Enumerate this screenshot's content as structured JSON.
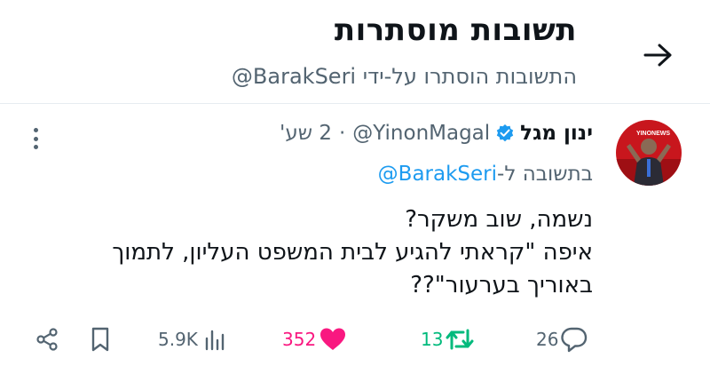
{
  "header": {
    "title": "תשובות מוסתרות",
    "subtitle": "התשובות הוסתרו על-ידי BarakSeri@"
  },
  "tweet": {
    "display_name": "ינון מגל",
    "handle": "@YinonMagal",
    "separator": "·",
    "time": "2 שע'",
    "reply_prefix": "בתשובה ל-",
    "reply_handle": "@BarakSeri",
    "avatar_text": "YINONEWS",
    "text_lines": [
      "נשמה, שוב משקר?",
      "איפה \"קראתי להגיע לבית המשפט העליון, לתמוך",
      "באוריך בערעור\"??"
    ]
  },
  "actions": {
    "views": "5.9K",
    "likes": "352",
    "retweets": "13",
    "replies": "26"
  },
  "colors": {
    "accent": "#1d9bf0",
    "like": "#f91880",
    "retweet": "#00ba7c",
    "muted": "#536471",
    "text": "#0f1419"
  },
  "icons": [
    "back-arrow-icon",
    "verified-badge-icon",
    "more-icon",
    "share-icon",
    "bookmark-icon",
    "views-icon",
    "heart-icon",
    "retweet-icon",
    "reply-icon"
  ]
}
